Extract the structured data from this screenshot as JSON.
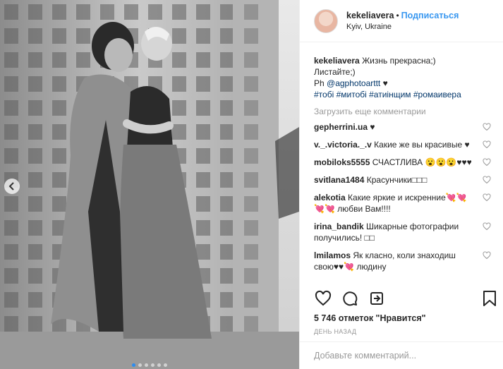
{
  "post": {
    "username": "kekeliavera",
    "separator": "•",
    "follow_label": "Подписаться",
    "location": "Kyiv, Ukraine"
  },
  "caption": {
    "username": "kekeliavera",
    "line1": "Жизнь прекрасна;)",
    "line2": "Листайте;)",
    "line3_prefix": "Ph ",
    "line3_mention": "@agphotoarttt",
    "line3_suffix": " ♥",
    "hashtags": "#тобі #митобі #атиінщим #ромаивера"
  },
  "load_more": "Загрузить еще комментарии",
  "comments": [
    {
      "user": "gepherrini.ua",
      "text": "♥"
    },
    {
      "user": "v._.victoria._.v",
      "text": "Какие же вы красивые ♥"
    },
    {
      "user": "mobiloks5555",
      "text": "СЧАСТЛИВА 😮😮😮♥♥♥"
    },
    {
      "user": "svitlana1484",
      "text": "Красунчики□□□"
    },
    {
      "user": "alekotia",
      "text": "Какие яркие и искренние💘💘💘💘 любви Вам!!!!"
    },
    {
      "user": "irina_bandik",
      "text": "Шикарные фотографии получились! □□"
    },
    {
      "user": "lmilamos",
      "text": "Як класно, коли знаходиш свою♥♥💘 людину"
    }
  ],
  "likes_text": "5 746 отметок \"Нравится\"",
  "time_text": "ДЕНЬ НАЗАД",
  "add_comment_placeholder": "Добавьте комментарий...",
  "icons": {
    "like": "heart-icon",
    "comment": "comment-icon",
    "share": "share-icon",
    "save": "bookmark-icon",
    "prev": "chevron-left-icon"
  },
  "carousel": {
    "slides": 6,
    "active": 0
  },
  "colors": {
    "accent": "#3897f0",
    "mention": "#003569",
    "muted": "#999999",
    "border": "#efefef"
  }
}
